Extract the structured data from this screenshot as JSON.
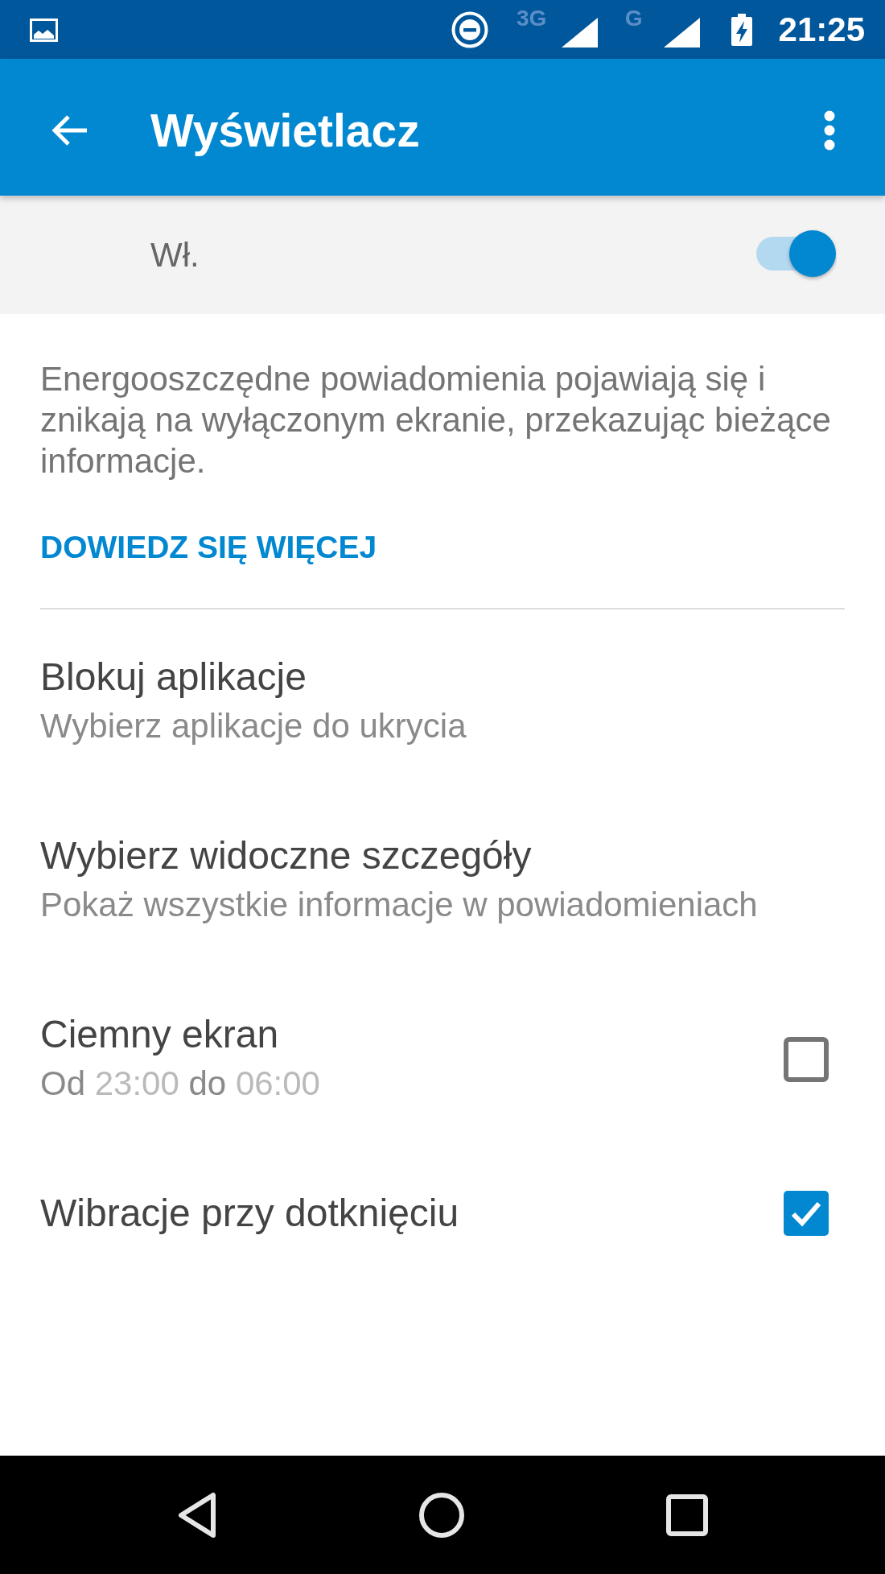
{
  "status_bar": {
    "network_signals": [
      {
        "label": "3G"
      },
      {
        "label": "G"
      }
    ],
    "time": "21:25"
  },
  "app_bar": {
    "title": "Wyświetlacz"
  },
  "master_switch": {
    "label": "Wł.",
    "on": true
  },
  "description": "Energooszczędne powiadomienia pojawiają się i znikają na wyłączonym ekranie, przekazując bieżące informacje.",
  "learn_more_link": "DOWIEDZ SIĘ WIĘCEJ",
  "settings": [
    {
      "kind": "link",
      "title": "Blokuj aplikacje",
      "summary_parts": [
        {
          "kind": "label",
          "text": "Wybierz aplikacje do ukrycia"
        }
      ]
    },
    {
      "kind": "link",
      "title": "Wybierz widoczne szczegóły",
      "summary_parts": [
        {
          "kind": "label",
          "text": "Pokaż wszystkie informacje w powiadomieniach"
        }
      ]
    },
    {
      "kind": "checkbox",
      "title": "Ciemny ekran",
      "checked": false,
      "summary_parts": [
        {
          "kind": "label",
          "text": "Od"
        },
        {
          "kind": "value",
          "text": "23:00"
        },
        {
          "kind": "label",
          "text": "do"
        },
        {
          "kind": "value",
          "text": "06:00"
        }
      ]
    },
    {
      "kind": "checkbox",
      "title": "Wibracje przy dotknięciu",
      "checked": true
    }
  ]
}
